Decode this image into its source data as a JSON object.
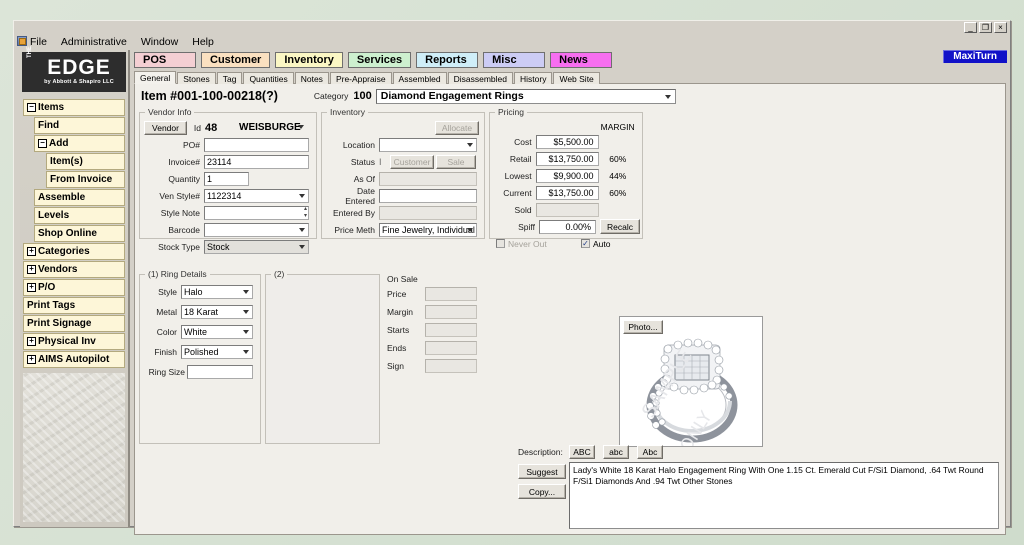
{
  "window": {
    "controls": [
      "_",
      "❐",
      "×"
    ],
    "menu": [
      "File",
      "Administrative",
      "Window",
      "Help"
    ],
    "maxiturn": "MaxiTurn"
  },
  "logo": {
    "the": "THE",
    "name": "EDGE",
    "tagline": "by Abbott & Shapiro LLC"
  },
  "sidebar": {
    "items": [
      {
        "label": "Items",
        "box": "−",
        "level": 0
      },
      {
        "label": "Find",
        "box": "",
        "level": 1
      },
      {
        "label": "Add",
        "box": "−",
        "level": 1
      },
      {
        "label": "Item(s)",
        "box": "",
        "level": 2
      },
      {
        "label": "From Invoice",
        "box": "",
        "level": 2
      },
      {
        "label": "Assemble",
        "box": "",
        "level": 1
      },
      {
        "label": "Levels",
        "box": "",
        "level": 1
      },
      {
        "label": "Shop Online",
        "box": "",
        "level": 1
      },
      {
        "label": "Categories",
        "box": "+",
        "level": 0
      },
      {
        "label": "Vendors",
        "box": "+",
        "level": 0
      },
      {
        "label": "P/O",
        "box": "+",
        "level": 0
      },
      {
        "label": "Print Tags",
        "box": "",
        "level": 0
      },
      {
        "label": "Print Signage",
        "box": "",
        "level": 0
      },
      {
        "label": "Physical Inv",
        "box": "+",
        "level": 0
      },
      {
        "label": "AIMS Autopilot",
        "box": "+",
        "level": 0
      }
    ]
  },
  "main_tabs": [
    {
      "label": "POS",
      "color": "#f4cfd3"
    },
    {
      "label": "Customer",
      "color": "#fae0c0"
    },
    {
      "label": "Inventory",
      "color": "#fbf7c4"
    },
    {
      "label": "Services",
      "color": "#cdf0cf"
    },
    {
      "label": "Reports",
      "color": "#cfeef8"
    },
    {
      "label": "Misc",
      "color": "#ccccf5"
    },
    {
      "label": "News",
      "color": "#f76ef0"
    }
  ],
  "sub_tabs": [
    {
      "label": "General",
      "active": true
    },
    {
      "label": "Stones",
      "active": false
    },
    {
      "label": "Tag",
      "active": false
    },
    {
      "label": "Quantities",
      "active": false
    },
    {
      "label": "Notes",
      "active": false
    },
    {
      "label": "Pre-Appraise",
      "active": false
    },
    {
      "label": "Assembled",
      "active": false
    },
    {
      "label": "Disassembled",
      "active": false
    },
    {
      "label": "History",
      "active": false
    },
    {
      "label": "Web Site",
      "active": false
    }
  ],
  "header": {
    "item_number": "Item #001-100-00218(?)",
    "category_label": "Category",
    "category_number": "100",
    "category_name": "Diamond Engagement Rings"
  },
  "vendor_info": {
    "legend": "Vendor Info",
    "vendor_button": "Vendor",
    "id_label": "Id",
    "id_value": "48",
    "vendor_name": "WEISBURGE",
    "po_label": "PO#",
    "po_value": "",
    "invoice_label": "Invoice#",
    "invoice_value": "23114",
    "quantity_label": "Quantity",
    "quantity_value": "1",
    "ven_style_label": "Ven Style#",
    "ven_style_value": "1122314",
    "style_note_label": "Style Note",
    "style_note_value": "",
    "barcode_label": "Barcode",
    "barcode_value": "",
    "stock_type_label": "Stock Type",
    "stock_type_value": "Stock"
  },
  "inventory": {
    "legend": "Inventory",
    "allocate_button": "Allocate",
    "location_label": "Location",
    "location_value": "",
    "status_label": "Status",
    "status_value": "I",
    "customer_button": "Customer",
    "sale_button": "Sale",
    "as_of_label": "As Of",
    "as_of_value": "",
    "date_entered_label": "Date Entered",
    "date_entered_value": "",
    "entered_by_label": "Entered By",
    "entered_by_value": "",
    "price_meth_label": "Price Meth",
    "price_meth_value": "Fine Jewelry, Individual Item"
  },
  "pricing": {
    "legend": "Pricing",
    "margin_header": "MARGIN",
    "rows": [
      {
        "label": "Cost",
        "value": "$5,500.00",
        "margin": ""
      },
      {
        "label": "Retail",
        "value": "$13,750.00",
        "margin": "60%"
      },
      {
        "label": "Lowest",
        "value": "$9,900.00",
        "margin": "44%"
      },
      {
        "label": "Current",
        "value": "$13,750.00",
        "margin": "60%"
      },
      {
        "label": "Sold",
        "value": "",
        "margin": ""
      }
    ],
    "spiff_label": "Spiff",
    "spiff_value": "0.00%",
    "recalc_button": "Recalc",
    "never_out_label": "Never Out",
    "never_out_checked": "",
    "auto_label": "Auto",
    "auto_checked": "✓"
  },
  "ring_details": {
    "legend": "(1) Ring Details",
    "style_label": "Style",
    "style_value": "Halo",
    "metal_label": "Metal",
    "metal_value": "18 Karat",
    "color_label": "Color",
    "color_value": "White",
    "finish_label": "Finish",
    "finish_value": "Polished",
    "ring_size_label": "Ring Size",
    "ring_size_value": ""
  },
  "panel2": {
    "legend": "(2)"
  },
  "on_sale": {
    "legend": "On Sale",
    "rows": [
      {
        "label": "Price",
        "value": ""
      },
      {
        "label": "Margin",
        "value": ""
      },
      {
        "label": "Starts",
        "value": ""
      },
      {
        "label": "Ends",
        "value": ""
      },
      {
        "label": "Sign",
        "value": ""
      }
    ]
  },
  "photo": {
    "button": "Photo..."
  },
  "description": {
    "label": "Description:",
    "case_buttons": [
      "ABC",
      "abc",
      "Abc"
    ],
    "suggest_button": "Suggest",
    "copy_button": "Copy...",
    "text": "Lady's White 18 Karat Halo Engagement Ring With One 1.15 Ct. Emerald Cut F/Si1 Diamond, .64 Twt Round F/Si1 Diamonds And .94 Twt Other Stones"
  }
}
